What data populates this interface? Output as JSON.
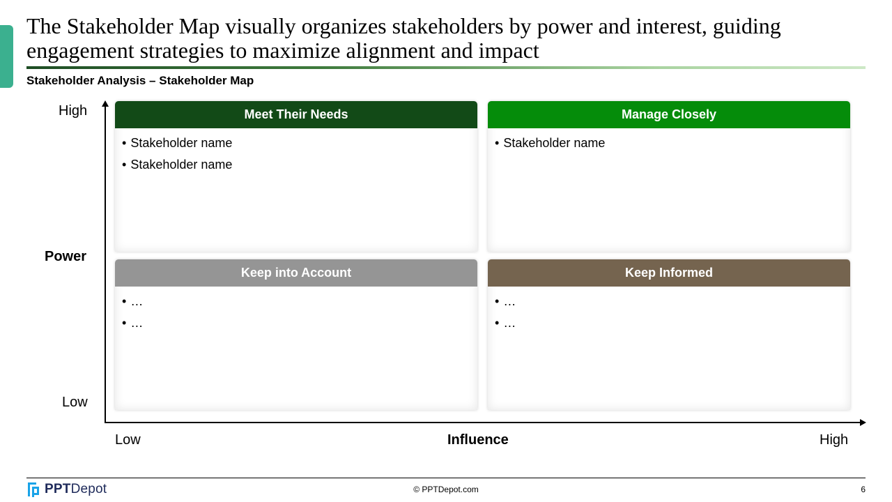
{
  "slide": {
    "title": "The Stakeholder Map visually organizes stakeholders by power and interest, guiding engagement strategies to maximize alignment and impact",
    "subtitle": "Stakeholder Analysis – Stakeholder Map",
    "accent_color": "#3bb08f"
  },
  "y_axis": {
    "label": "Power",
    "high": "High",
    "low": "Low"
  },
  "x_axis": {
    "label": "Influence",
    "low": "Low",
    "high": "High"
  },
  "quadrants": [
    {
      "title": "Meet Their Needs",
      "color": "#124a17",
      "items": [
        "Stakeholder name",
        "Stakeholder name"
      ]
    },
    {
      "title": "Manage Closely",
      "color": "#058c0a",
      "items": [
        "Stakeholder name"
      ]
    },
    {
      "title": "Keep into Account",
      "color": "#959595",
      "items": [
        "…",
        "…"
      ]
    },
    {
      "title": "Keep Informed",
      "color": "#75644f",
      "items": [
        "…",
        "…"
      ]
    }
  ],
  "footer": {
    "logo_bold": "PPT",
    "logo_rest": "Depot",
    "copyright": "© PPTDepot.com",
    "page_number": "6"
  }
}
